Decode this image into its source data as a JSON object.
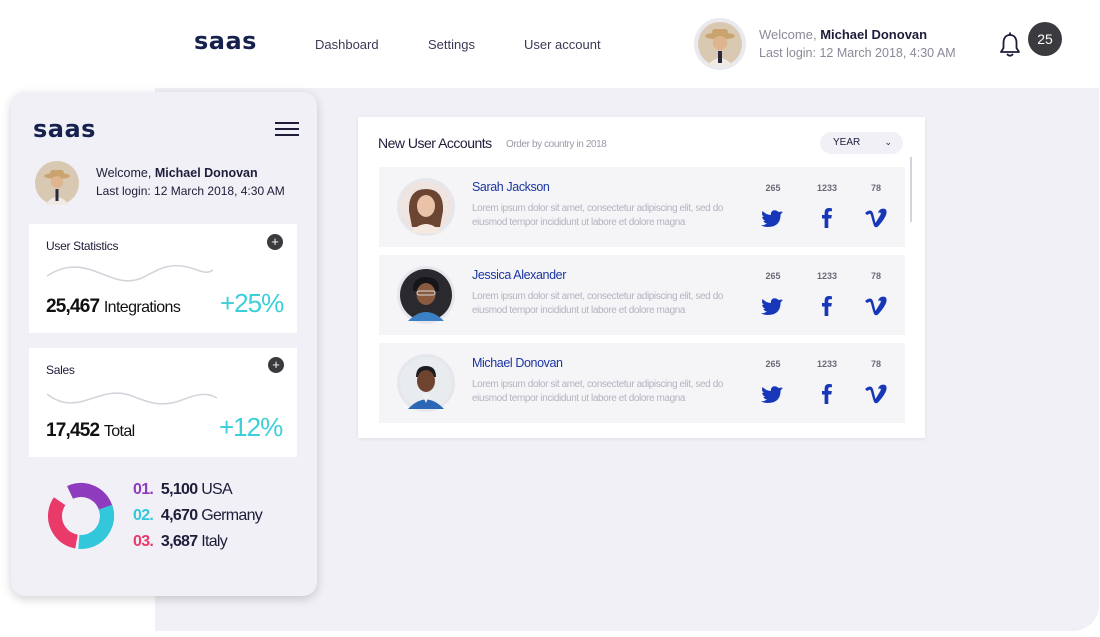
{
  "header": {
    "logo": "saas",
    "nav": [
      "Dashboard",
      "Settings",
      "User account"
    ],
    "welcome_prefix": "Welcome,",
    "user_name": "Michael Donovan",
    "last_login": "Last login: 12 March 2018, 4:30 AM",
    "notification_count": "25"
  },
  "sidebar": {
    "logo": "saas",
    "welcome_prefix": "Welcome,",
    "user_name": "Michael Donovan",
    "last_login": "Last login: 12 March 2018, 4:30 AM",
    "cards": [
      {
        "title": "User Statistics",
        "value": "25,467",
        "unit": "Integrations",
        "change": "+25%"
      },
      {
        "title": "Sales",
        "value": "17,452",
        "unit": "Total",
        "change": "+12%"
      }
    ],
    "countries": [
      {
        "rank": "01.",
        "value": "5,100",
        "name": "USA",
        "color": "#8e3bbd"
      },
      {
        "rank": "02.",
        "value": "4,670",
        "name": "Germany",
        "color": "#33c7dc"
      },
      {
        "rank": "03.",
        "value": "3,687",
        "name": "Italy",
        "color": "#ea3a69"
      }
    ]
  },
  "accounts": {
    "title": "New User Accounts",
    "subtitle": "Order by country in 2018",
    "filter": "YEAR",
    "users": [
      {
        "name": "Sarah Jackson",
        "desc": "Lorem ipsum dolor sit amet, consectetur adipiscing elit, sed do eiusmod tempor incididunt ut labore et dolore magna",
        "twitter": "265",
        "facebook": "1233",
        "vimeo": "78"
      },
      {
        "name": "Jessica Alexander",
        "desc": "Lorem ipsum dolor sit amet, consectetur adipiscing elit, sed do eiusmod tempor incididunt ut labore et dolore magna",
        "twitter": "265",
        "facebook": "1233",
        "vimeo": "78"
      },
      {
        "name": "Michael Donovan",
        "desc": "Lorem ipsum dolor sit amet, consectetur adipiscing elit, sed do eiusmod tempor incididunt ut labore et dolore magna",
        "twitter": "265",
        "facebook": "1233",
        "vimeo": "78"
      }
    ]
  },
  "colors": {
    "accent": "#3ccfd9",
    "link": "#1a35a0",
    "social_icon": "#1537b8",
    "panel": "#f0f0f6"
  }
}
